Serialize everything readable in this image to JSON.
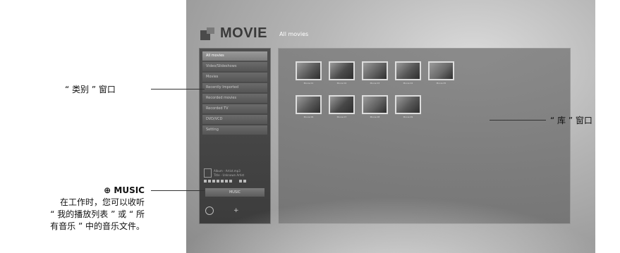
{
  "screen": {
    "logo_text": "MOVIE",
    "library_title": "All movies",
    "categories": [
      {
        "label": "All movies",
        "selected": true
      },
      {
        "label": "Video/Slideshows",
        "selected": false
      },
      {
        "label": "Movies",
        "selected": false
      },
      {
        "label": "Recently Imported",
        "selected": false
      },
      {
        "label": "Recorded movies",
        "selected": false
      },
      {
        "label": "Recorded TV",
        "selected": false
      },
      {
        "label": "DVD/VCD",
        "selected": false
      },
      {
        "label": "Setting",
        "selected": false
      }
    ],
    "music_info": {
      "line1": "Album - Artist.mp3",
      "line2": "Title - Unknown Artist"
    },
    "music_button": "MUSIC",
    "thumbnails": [
      {
        "caption": "Movie 01",
        "color": "#5a5a5a"
      },
      {
        "caption": "Movie 02",
        "color": "#4a4a4a"
      },
      {
        "caption": "Movie 03",
        "color": "#606060"
      },
      {
        "caption": "Movie 04",
        "color": "#555555"
      },
      {
        "caption": "Movie 05",
        "color": "#6a6a6a"
      },
      {
        "caption": "Movie 06",
        "color": "#585858"
      },
      {
        "caption": "Movie 07",
        "color": "#474747"
      },
      {
        "caption": "Movie 08",
        "color": "#626262"
      },
      {
        "caption": "Movie 09",
        "color": "#565656"
      }
    ]
  },
  "callouts": {
    "category_window": "“ 类别 ” 窗口",
    "library_window": "“ 库 ” 窗口",
    "music_title": "⊕ MUSIC",
    "music_desc_1": "在工作时，您可以收听",
    "music_desc_2": "“ 我的播放列表 ” 或 “ 所",
    "music_desc_3": "有音乐 ” 中的音乐文件。"
  }
}
